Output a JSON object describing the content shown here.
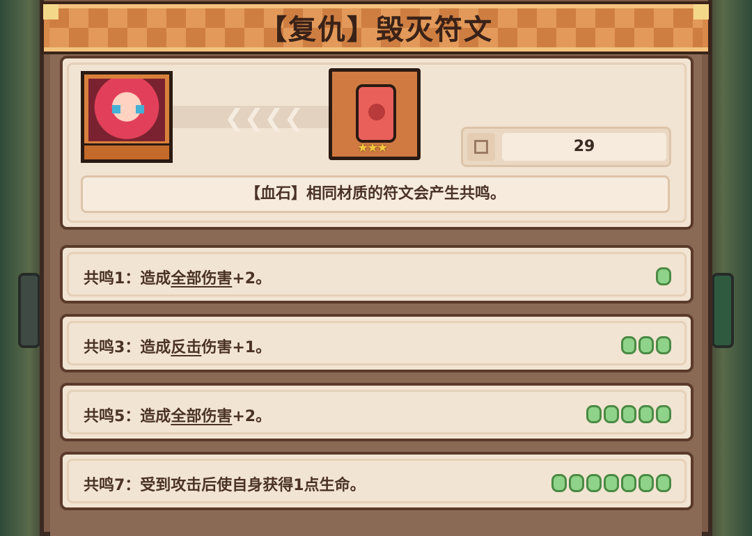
{
  "title": "【复仇】毁灭符文",
  "rune": {
    "count": "29",
    "stars": "★★★",
    "description": "【血石】相同材质的符文会产生共鸣。"
  },
  "resonances": [
    {
      "prefix": "共鸣1：造成",
      "link": "全部伤害",
      "suffix": "+2。",
      "dots": 1
    },
    {
      "prefix": "共鸣3：造成",
      "link": "反击",
      "suffix": "伤害+1。",
      "dots": 3
    },
    {
      "prefix": "共鸣5：造成",
      "link": "全部伤害",
      "suffix": "+2。",
      "dots": 5
    },
    {
      "prefix": "共鸣7：受到攻击后使自身获得1点生命。",
      "link": "",
      "suffix": "",
      "dots": 7
    }
  ],
  "icons": {
    "hero": "hero-portrait-icon",
    "rune": "blood-rune-icon",
    "count": "inventory-icon",
    "arrows": "chevron-left-icon"
  },
  "colors": {
    "header": "#d98a4a",
    "panel": "#f2e4d2",
    "frame": "#7b5a47",
    "dot": "#8fd38a"
  }
}
